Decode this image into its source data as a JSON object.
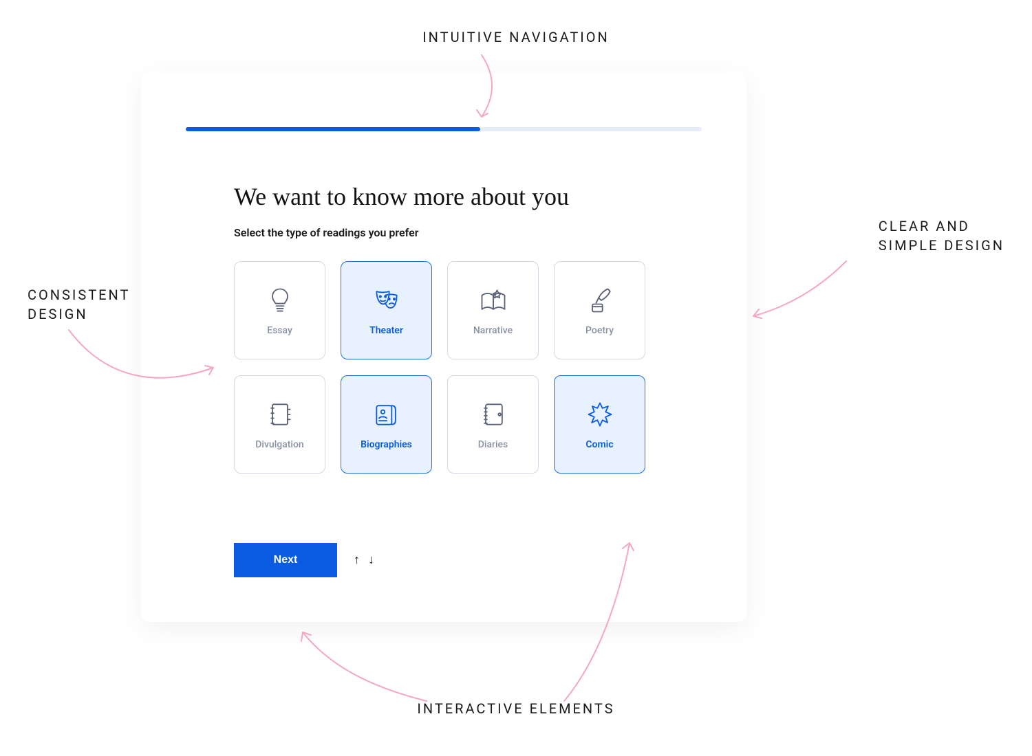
{
  "annotations": {
    "top": "INTUITIVE NAVIGATION",
    "left_line1": "CONSISTENT",
    "left_line2": "DESIGN",
    "right_line1": "CLEAR AND",
    "right_line2": "SIMPLE DESIGN",
    "bottom": "INTERACTIVE ELEMENTS"
  },
  "progress": {
    "percent": 57
  },
  "heading": {
    "title": "We want to know more about you",
    "subtitle": "Select the type of readings you prefer"
  },
  "options": {
    "essay": {
      "label": "Essay",
      "selected": false
    },
    "theater": {
      "label": "Theater",
      "selected": true
    },
    "narrative": {
      "label": "Narrative",
      "selected": false
    },
    "poetry": {
      "label": "Poetry",
      "selected": false
    },
    "divulgation": {
      "label": "Divulgation",
      "selected": false
    },
    "biographies": {
      "label": "Biographies",
      "selected": true
    },
    "diaries": {
      "label": "Diaries",
      "selected": false
    },
    "comic": {
      "label": "Comic",
      "selected": true
    }
  },
  "buttons": {
    "next": "Next"
  },
  "colors": {
    "accent": "#0a5be0",
    "selected_bg": "#e8f1fe",
    "muted": "#8a91a5",
    "border": "#d3d8e3",
    "icon_muted": "#5b6278",
    "annotation_arrow": "#f6a6c2"
  }
}
